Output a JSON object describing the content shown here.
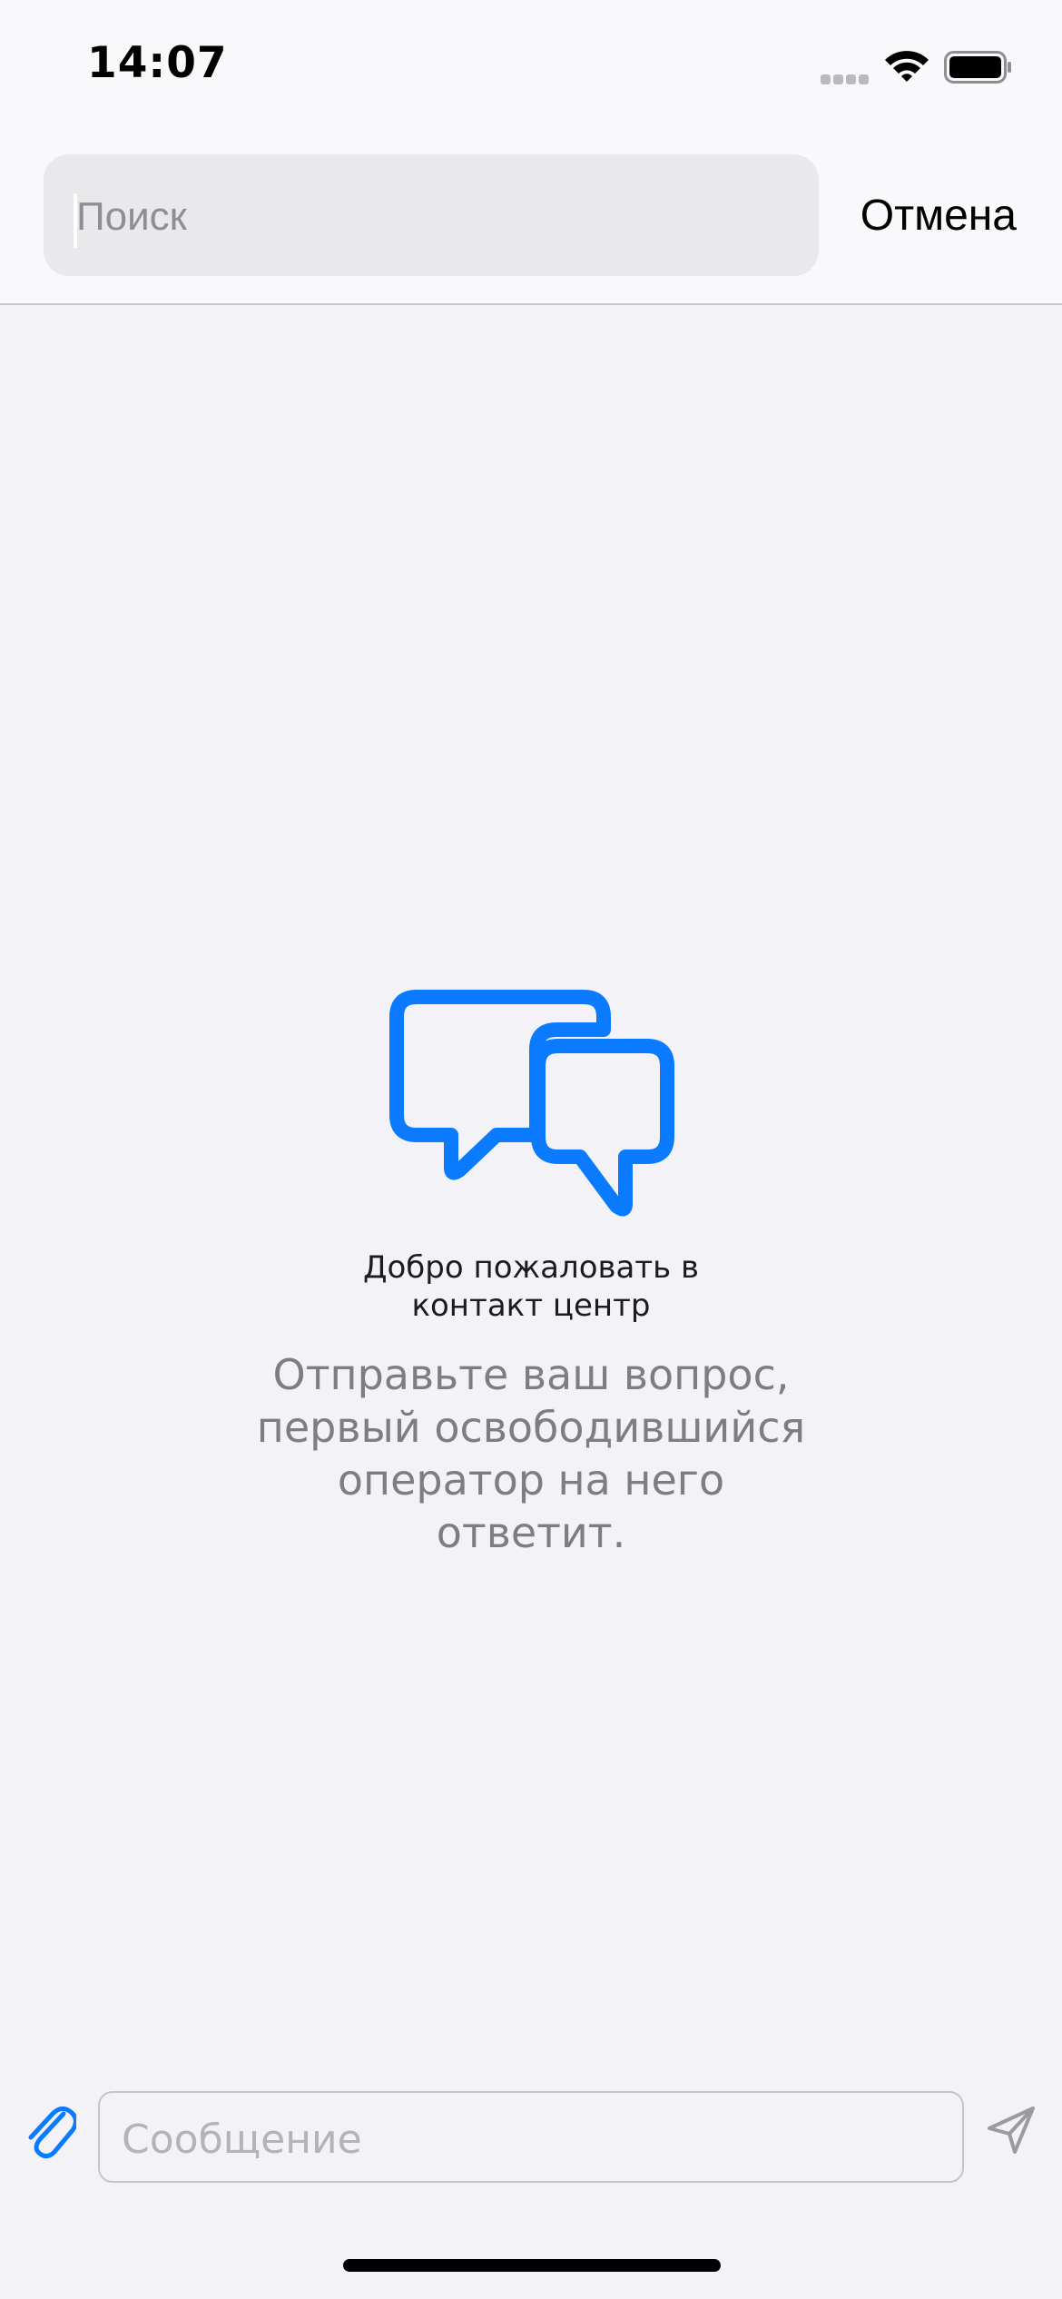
{
  "status_bar": {
    "time": "14:07"
  },
  "search": {
    "placeholder": "Поиск",
    "cancel_label": "Отмена"
  },
  "empty_state": {
    "icon": "two-chat-bubbles-icon",
    "title_line1": "Добро пожаловать в",
    "title_line2": "контакт центр",
    "text_line1": "Отправьте ваш вопрос,",
    "text_line2": "первый освободившийся",
    "text_line3": "оператор на него",
    "text_line4": "ответит.",
    "accent_color": "#0a7aff"
  },
  "composer": {
    "placeholder": "Сообщение",
    "attach_icon": "paperclip-icon",
    "send_icon": "paper-plane-icon"
  }
}
